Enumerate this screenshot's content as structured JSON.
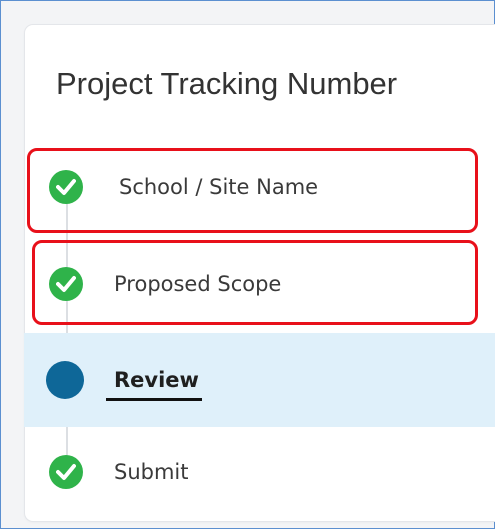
{
  "wizard": {
    "title": "Project Tracking Number",
    "steps": [
      {
        "label": "School / Site Name",
        "status": "complete",
        "icon": "check-circle-icon"
      },
      {
        "label": "Proposed Scope",
        "status": "complete",
        "icon": "check-circle-icon"
      },
      {
        "label": "Review",
        "status": "current",
        "icon": "current-step-dot-icon"
      },
      {
        "label": "Submit",
        "status": "complete",
        "icon": "check-circle-icon"
      }
    ]
  },
  "colors": {
    "complete": "#2fb34a",
    "current": "#0e6798",
    "active_row_bg": "#dff0fa",
    "annotation": "#e8101a"
  }
}
